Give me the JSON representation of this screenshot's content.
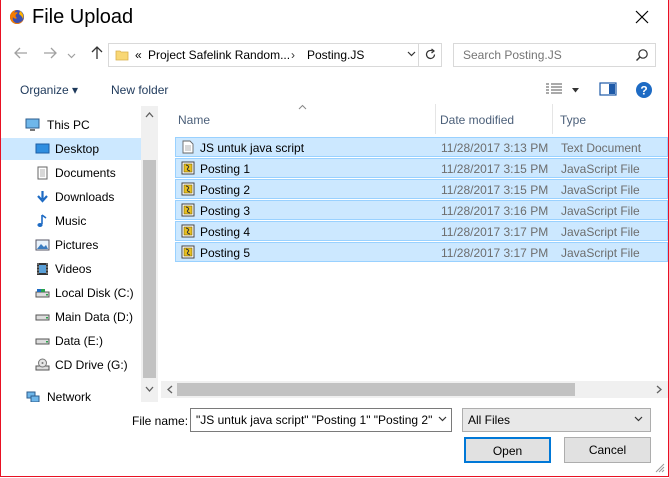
{
  "window": {
    "title": "File Upload",
    "accent": "#e81123"
  },
  "nav": {
    "back_icon": "arrow-left-icon",
    "forward_icon": "arrow-right-icon",
    "recent_icon": "chevron-down-icon",
    "up_icon": "arrow-up-icon"
  },
  "address": {
    "prefix": "«",
    "crumb1": "Project Safelink Random...",
    "sep": "›",
    "crumb2": "Posting.JS"
  },
  "search": {
    "placeholder": "Search Posting.JS"
  },
  "toolbar": {
    "organize": "Organize ▾",
    "new_folder": "New folder"
  },
  "sidebar": {
    "items": [
      {
        "label": "This PC",
        "icon": "computer-icon"
      },
      {
        "label": "Desktop",
        "icon": "desktop-icon"
      },
      {
        "label": "Documents",
        "icon": "documents-icon"
      },
      {
        "label": "Downloads",
        "icon": "downloads-icon"
      },
      {
        "label": "Music",
        "icon": "music-icon"
      },
      {
        "label": "Pictures",
        "icon": "pictures-icon"
      },
      {
        "label": "Videos",
        "icon": "videos-icon"
      },
      {
        "label": "Local Disk (C:)",
        "icon": "drive-icon"
      },
      {
        "label": "Main Data (D:)",
        "icon": "drive-icon"
      },
      {
        "label": "Data (E:)",
        "icon": "drive-icon"
      },
      {
        "label": "CD Drive (G:)",
        "icon": "cd-drive-icon"
      },
      {
        "label": "Network",
        "icon": "network-icon"
      }
    ]
  },
  "columns": {
    "name": "Name",
    "date": "Date modified",
    "type": "Type"
  },
  "files": [
    {
      "name": "JS untuk java script",
      "date": "11/28/2017 3:13 PM",
      "type": "Text Document"
    },
    {
      "name": "Posting 1",
      "date": "11/28/2017 3:15 PM",
      "type": "JavaScript File"
    },
    {
      "name": "Posting 2",
      "date": "11/28/2017 3:15 PM",
      "type": "JavaScript File"
    },
    {
      "name": "Posting 3",
      "date": "11/28/2017 3:16 PM",
      "type": "JavaScript File"
    },
    {
      "name": "Posting 4",
      "date": "11/28/2017 3:17 PM",
      "type": "JavaScript File"
    },
    {
      "name": "Posting 5",
      "date": "11/28/2017 3:17 PM",
      "type": "JavaScript File"
    }
  ],
  "footer": {
    "file_name_label": "File name:",
    "file_name_value": "\"JS untuk java script\" \"Posting 1\" \"Posting 2\"",
    "file_type_value": "All Files",
    "open_label": "Open",
    "cancel_label": "Cancel"
  },
  "colors": {
    "selection": "#cce8ff",
    "selection_border": "#99d1ff",
    "open_border": "#0078d7"
  }
}
